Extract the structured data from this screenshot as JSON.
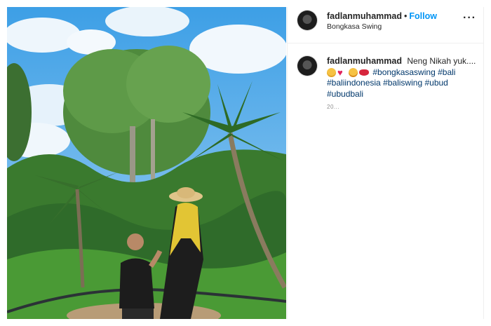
{
  "post": {
    "username": "fadlanmuhammad",
    "separator": "•",
    "follow_label": "Follow",
    "location": "Bongkasa Swing",
    "more_label": "···"
  },
  "caption": {
    "username": "fadlanmuhammad",
    "text": "Neng Nikah yuk....",
    "emojis": [
      "smiling-face",
      "red-heart",
      "grinning-face",
      "lips"
    ],
    "hashtags": [
      "#bongkasaswing",
      "#bali",
      "#baliindonesia",
      "#baliswing",
      "#ubud",
      "#ubudbali"
    ],
    "timestamp": "20..."
  },
  "colors": {
    "follow": "#0095f6",
    "hashtag": "#00376b",
    "sky": "#5ab4ee",
    "jungle": "#2f6b2a"
  }
}
